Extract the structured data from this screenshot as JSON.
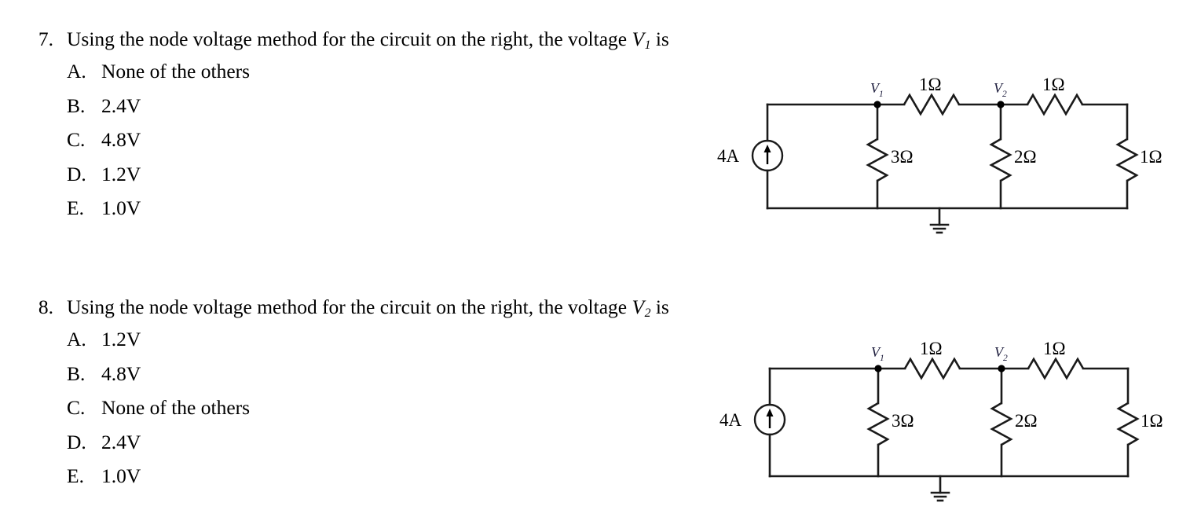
{
  "questions": [
    {
      "number": "7.",
      "stem_before": "Using the node voltage method for the circuit on the right, the voltage",
      "stem_variable": "V",
      "stem_variable_sub": "1",
      "stem_after": "is",
      "options": [
        {
          "letter": "A.",
          "text": "None of the others"
        },
        {
          "letter": "B.",
          "text": "2.4V"
        },
        {
          "letter": "C.",
          "text": "4.8V"
        },
        {
          "letter": "D.",
          "text": "1.2V"
        },
        {
          "letter": "E.",
          "text": "1.0V"
        }
      ]
    },
    {
      "number": "8.",
      "stem_before": "Using the node voltage method for the circuit on the right, the voltage",
      "stem_variable": "V",
      "stem_variable_sub": "2",
      "stem_after": "is",
      "options": [
        {
          "letter": "A.",
          "text": "1.2V"
        },
        {
          "letter": "B.",
          "text": "4.8V"
        },
        {
          "letter": "C.",
          "text": "None of the others"
        },
        {
          "letter": "D.",
          "text": "2.4V"
        },
        {
          "letter": "E.",
          "text": "1.0V"
        }
      ]
    }
  ],
  "circuit": {
    "source_label": "4A",
    "node1_label": "V",
    "node1_sub": "1",
    "node2_label": "V",
    "node2_sub": "2",
    "r_top_left_label": "1Ω",
    "r_top_right_label": "1Ω",
    "r_shunt1_label": "3Ω",
    "r_shunt2_label": "2Ω",
    "r_shunt3_label": "1Ω",
    "ground_symbol": "ground-icon",
    "stroke_color": "#1a1a1a"
  }
}
